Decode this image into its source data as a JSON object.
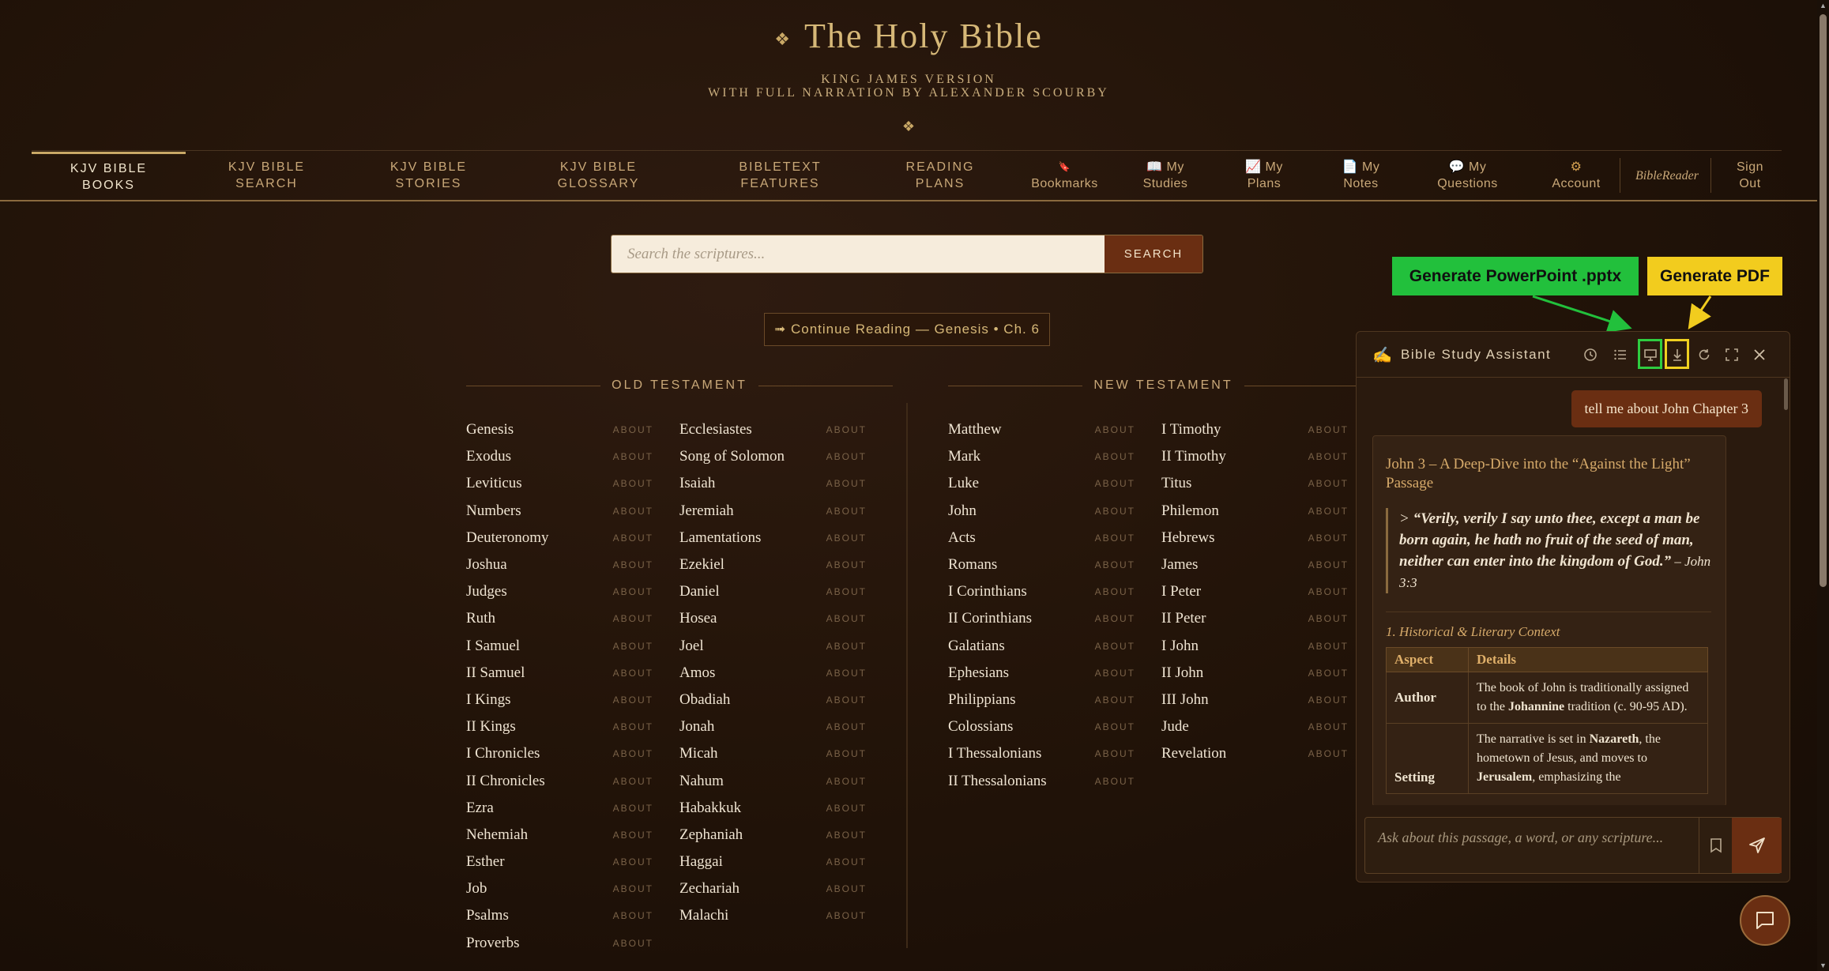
{
  "header": {
    "title": "The Holy Bible",
    "title_ornament": "❖",
    "subtitle_line1": "KING JAMES VERSION",
    "subtitle_line2": "WITH FULL NARRATION BY ALEXANDER SCOURBY",
    "ornament": "❖"
  },
  "nav": {
    "items": [
      {
        "line1": "KJV BIBLE",
        "line2": "BOOKS"
      },
      {
        "line1": "KJV BIBLE",
        "line2": "SEARCH"
      },
      {
        "line1": "KJV BIBLE",
        "line2": "STORIES"
      },
      {
        "line1": "KJV BIBLE",
        "line2": "GLOSSARY"
      },
      {
        "line1": "BIBLETEXT",
        "line2": "FEATURES"
      },
      {
        "line1": "READING",
        "line2": "PLANS"
      },
      {
        "line1": "🔖",
        "line2": "Bookmarks"
      },
      {
        "line1": "📖 My",
        "line2": "Studies"
      },
      {
        "line1": "📈 My",
        "line2": "Plans"
      },
      {
        "line1": "📄 My",
        "line2": "Notes"
      },
      {
        "line1": "💬 My",
        "line2": "Questions"
      },
      {
        "line1": "⚙",
        "line2": "Account"
      },
      {
        "line1": "BibleReader",
        "line2": ""
      },
      {
        "line1": "Sign",
        "line2": "Out"
      }
    ]
  },
  "search": {
    "placeholder": "Search the scriptures...",
    "button_label": "SEARCH"
  },
  "continue_reading": "➟ Continue Reading — Genesis • Ch. 6",
  "old_testament": {
    "heading": "OLD TESTAMENT",
    "col1": [
      "Genesis",
      "Exodus",
      "Leviticus",
      "Numbers",
      "Deuteronomy",
      "Joshua",
      "Judges",
      "Ruth",
      "I Samuel",
      "II Samuel",
      "I Kings",
      "II Kings",
      "I Chronicles",
      "II Chronicles",
      "Ezra",
      "Nehemiah",
      "Esther",
      "Job",
      "Psalms",
      "Proverbs"
    ],
    "col2": [
      "Ecclesiastes",
      "Song of Solomon",
      "Isaiah",
      "Jeremiah",
      "Lamentations",
      "Ezekiel",
      "Daniel",
      "Hosea",
      "Joel",
      "Amos",
      "Obadiah",
      "Jonah",
      "Micah",
      "Nahum",
      "Habakkuk",
      "Zephaniah",
      "Haggai",
      "Zechariah",
      "Malachi"
    ]
  },
  "new_testament": {
    "heading": "NEW TESTAMENT",
    "col1": [
      "Matthew",
      "Mark",
      "Luke",
      "John",
      "Acts",
      "Romans",
      "I Corinthians",
      "II Corinthians",
      "Galatians",
      "Ephesians",
      "Philippians",
      "Colossians",
      "I Thessalonians",
      "II Thessalonians"
    ],
    "col2": [
      "I Timothy",
      "II Timothy",
      "Titus",
      "Philemon",
      "Hebrews",
      "James",
      "I Peter",
      "II Peter",
      "I John",
      "II John",
      "III John",
      "Jude",
      "Revelation"
    ]
  },
  "about_label": "ABOUT",
  "assistant": {
    "title": "Bible Study Assistant",
    "user_message": "tell me about John Chapter 3",
    "reply_heading": "John 3 – A Deep‑Dive into the “Against the Light” Passage",
    "quote_prefix": "> ",
    "quote_text": "“Verily, verily I say unto thee, except a man be born again, he hath no fruit of the seed of man, neither can enter into the kingdom of God.”",
    "quote_ref": " – John 3:3",
    "context_heading": "1. Historical & Literary Context",
    "table_headers": [
      "Aspect",
      "Details"
    ],
    "author_key": "Author",
    "author_pre": "The book of John is traditionally assigned to the ",
    "author_bold": "Johannine",
    "author_post": " tradition (c. 90‑95 AD).",
    "setting_key": "Setting",
    "setting_pre": "The narrative is set in ",
    "setting_bold1": "Nazareth",
    "setting_mid": ", the hometown of Jesus, and moves to ",
    "setting_bold2": "Jerusalem",
    "setting_post": ", emphasizing the",
    "input_placeholder": "Ask about this passage, a word, or any scripture..."
  },
  "annotations": {
    "pptx_label": "Generate PowerPoint .pptx",
    "pdf_label": "Generate PDF",
    "pptx_color": "#22c03c",
    "pdf_color": "#f2cc1e"
  },
  "colors": {
    "accent": "#c9a866",
    "button_brown": "#6a2e12"
  }
}
